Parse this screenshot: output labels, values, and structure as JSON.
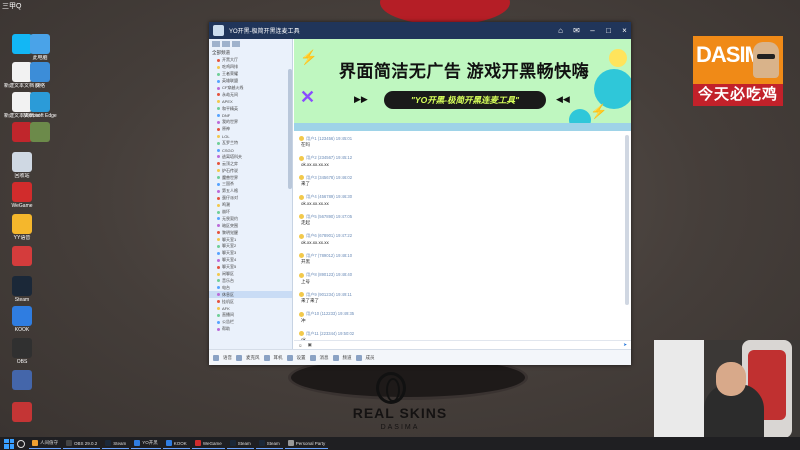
{
  "desktop": {
    "brand_logo_text": "DASIMA",
    "slogan": "今天必吃鸡",
    "mousepad_title": "REAL SKINS",
    "mousepad_sub": "DASIMA",
    "icons": [
      {
        "name": "qq-icon",
        "label": "",
        "color": "#12b7f5"
      },
      {
        "name": "computer-icon",
        "label": "此电脑",
        "color": "#4aa3e8"
      },
      {
        "name": "text-doc-icon",
        "label": "新建文本文档 (2).txt",
        "color": "#f2f2f2"
      },
      {
        "name": "network-icon",
        "label": "网络",
        "color": "#3c8dd8"
      },
      {
        "name": "text-doc2-icon",
        "label": "新建文本文档.txt",
        "color": "#f2f2f2"
      },
      {
        "name": "edge-icon",
        "label": "Microsoft Edge",
        "color": "#2b9bd8"
      },
      {
        "name": "app-red-icon",
        "label": "",
        "color": "#c0262c"
      },
      {
        "name": "recycle-icon",
        "label": "回收站",
        "color": "#cfd8e3"
      },
      {
        "name": "wegame-icon",
        "label": "WeGame",
        "color": "#d12c2c"
      },
      {
        "name": "yy-icon",
        "label": "YY语音",
        "color": "#f5b72c"
      },
      {
        "name": "pubg-icon",
        "label": "",
        "color": "#d43c3c"
      },
      {
        "name": "steam-icon",
        "label": "Steam",
        "color": "#1b2838"
      },
      {
        "name": "kook-icon",
        "label": "KOOK",
        "color": "#2f7de1"
      },
      {
        "name": "obs-icon",
        "label": "OBS",
        "color": "#303030"
      },
      {
        "name": "settings-icon",
        "label": "",
        "color": "#4466aa"
      },
      {
        "name": "game-icon",
        "label": "",
        "color": "#c43535"
      },
      {
        "name": "map-icon",
        "label": "",
        "color": "#6c8a4a"
      }
    ]
  },
  "window": {
    "title": "YO开黑-极简开黑连麦工具",
    "banner_headline": "界面简洁无广告 游戏开黑畅快嗨",
    "banner_pill": "\"YO开黑-极简开黑连麦工具\"",
    "sidebar": {
      "header": "全部频道",
      "rows": [
        "开黑大厅",
        "吃鸡四排",
        "王者荣耀",
        "英雄联盟",
        "CF穿越火线",
        "永劫无间",
        "APEX",
        "和平精英",
        "DNF",
        "我的世界",
        "原神",
        "LOL",
        "瓦罗兰特",
        "CSGO",
        "逃离塔科夫",
        "云顶之弈",
        "炉石传说",
        "魔兽世界",
        "三国杀",
        "第五人格",
        "蛋仔派对",
        "鸣潮",
        "崩坏",
        "无畏契约",
        "暗区突围",
        "黎明觉醒",
        "聊天室1",
        "聊天室2",
        "聊天室3",
        "聊天室4",
        "聊天室5",
        "闲聊区",
        "音乐台",
        "电台",
        "休息区",
        "挂机区",
        "AFK",
        "直播间",
        "公告栏",
        "帮助"
      ]
    },
    "messages": [
      {
        "meta": "用户1 (123456) 19:45:01",
        "body": "在吗"
      },
      {
        "meta": "用户2 (234567) 19:45:12",
        "body": "ok.xx.xx.xx.xx"
      },
      {
        "meta": "用户3 (345678) 19:46:02",
        "body": "来了"
      },
      {
        "meta": "用户4 (456789) 19:46:30",
        "body": "ok.xx.xx.xx.xx"
      },
      {
        "meta": "用户5 (567890) 19:47:05",
        "body": "走起"
      },
      {
        "meta": "用户6 (678901) 19:47:22",
        "body": "ok.xx.xx.xx.xx"
      },
      {
        "meta": "用户7 (789012) 19:48:10",
        "body": "开黑"
      },
      {
        "meta": "用户8 (890123) 19:48:40",
        "body": "上号"
      },
      {
        "meta": "用户9 (901234) 19:49:11",
        "body": "来了来了"
      },
      {
        "meta": "用户10 (112233) 19:49:35",
        "body": "冲"
      },
      {
        "meta": "用户11 (223344) 19:50:02",
        "body": "ok"
      },
      {
        "meta": "用户12 (334455) 19:50:28",
        "body": "走"
      }
    ],
    "status_items": [
      "语音",
      "麦克风",
      "耳机",
      "设置",
      "消息",
      "频道",
      "成员"
    ]
  },
  "taskbar": {
    "items": [
      {
        "label": "人间值守",
        "color": "#f0a030"
      },
      {
        "label": "OBS 29.0.2",
        "color": "#444"
      },
      {
        "label": "Steam",
        "color": "#1b2838"
      },
      {
        "label": "YO开黑",
        "color": "#2f7de1"
      },
      {
        "label": "KOOK",
        "color": "#2f7de1"
      },
      {
        "label": "WeGame",
        "color": "#d12c2c"
      },
      {
        "label": "Steam",
        "color": "#1b2838"
      },
      {
        "label": "Steam",
        "color": "#1b2838"
      },
      {
        "label": "Personal Party",
        "color": "#999"
      }
    ]
  }
}
